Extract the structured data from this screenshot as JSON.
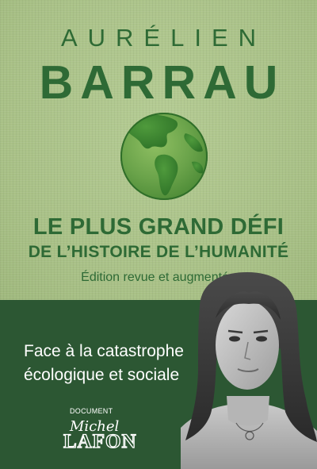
{
  "author": {
    "first_name": "AURÉLIEN",
    "last_name": "BARRAU"
  },
  "title": {
    "line1": "LE PLUS GRAND DÉFI",
    "line2": "DE L’HISTOIRE DE L’HUMANITÉ"
  },
  "edition_note": "Édition revue et augmentée",
  "tagline": {
    "line1": "Face à la catastrophe",
    "line2": "écologique et sociale"
  },
  "collection": "DOCUMENT",
  "publisher": {
    "line1": "Michel",
    "line2": "LAFON"
  },
  "icons": {
    "globe": "grass-globe-icon",
    "portrait": "author-portrait"
  },
  "colors": {
    "top_background": "#adc58b",
    "bottom_band": "#2c5733",
    "title_green": "#2e6a35",
    "globe_green": "#3f8a3a",
    "text_light": "#ffffff"
  }
}
